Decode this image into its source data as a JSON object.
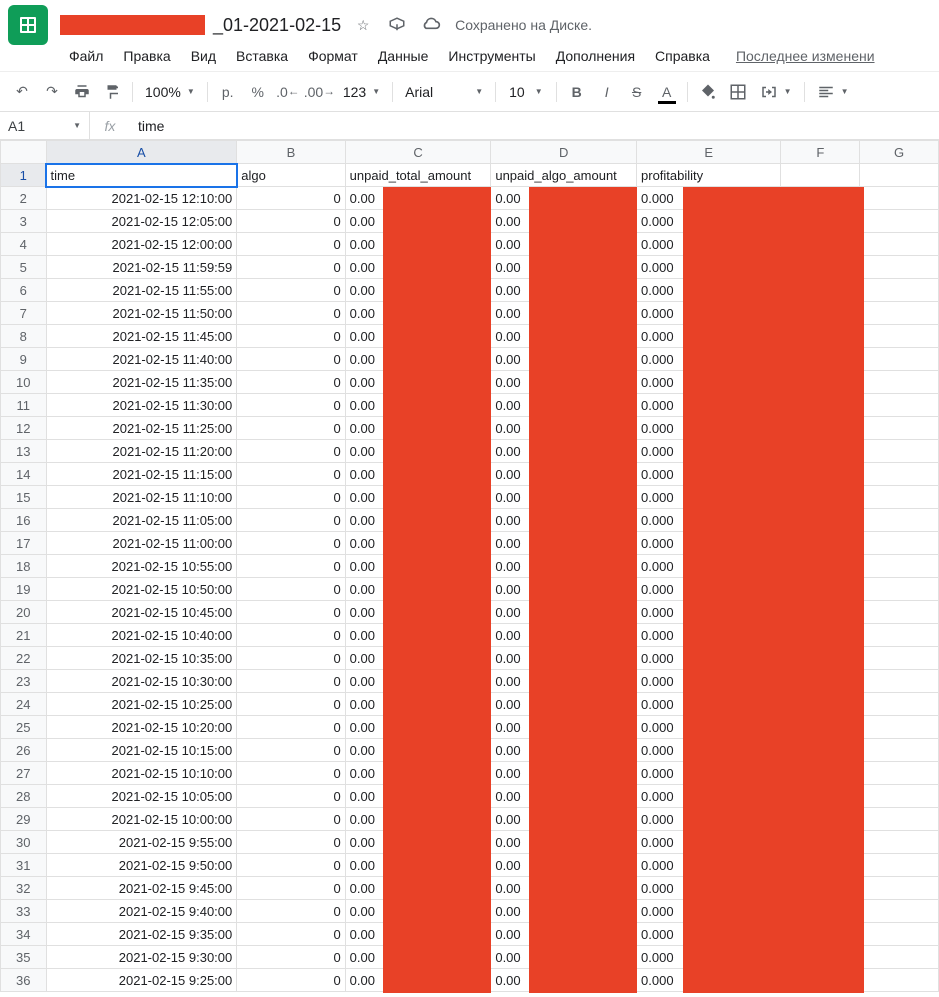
{
  "header": {
    "title_suffix": "_01-2021-02-15",
    "saved_text": "Сохранено на Диске."
  },
  "menu": {
    "items": [
      "Файл",
      "Правка",
      "Вид",
      "Вставка",
      "Формат",
      "Данные",
      "Инструменты",
      "Дополнения",
      "Справка"
    ],
    "last_edit": "Последнее изменени"
  },
  "toolbar": {
    "zoom": "100%",
    "currency": "р.",
    "font": "Arial",
    "font_size": "10"
  },
  "namebox": {
    "cell": "A1",
    "value": "time"
  },
  "columns": [
    "A",
    "B",
    "C",
    "D",
    "E",
    "F",
    "G"
  ],
  "headers": {
    "A": "time",
    "B": "algo",
    "C": "unpaid_total_amount",
    "D": "unpaid_algo_amount",
    "E": "profitability"
  },
  "rows": [
    {
      "n": 2,
      "time": "2021-02-15 12:10:00",
      "algo": "0",
      "c": "0.00",
      "d": "0.00",
      "e": "0.000"
    },
    {
      "n": 3,
      "time": "2021-02-15 12:05:00",
      "algo": "0",
      "c": "0.00",
      "d": "0.00",
      "e": "0.000"
    },
    {
      "n": 4,
      "time": "2021-02-15 12:00:00",
      "algo": "0",
      "c": "0.00",
      "d": "0.00",
      "e": "0.000"
    },
    {
      "n": 5,
      "time": "2021-02-15 11:59:59",
      "algo": "0",
      "c": "0.00",
      "d": "0.00",
      "e": "0.000"
    },
    {
      "n": 6,
      "time": "2021-02-15 11:55:00",
      "algo": "0",
      "c": "0.00",
      "d": "0.00",
      "e": "0.000"
    },
    {
      "n": 7,
      "time": "2021-02-15 11:50:00",
      "algo": "0",
      "c": "0.00",
      "d": "0.00",
      "e": "0.000"
    },
    {
      "n": 8,
      "time": "2021-02-15 11:45:00",
      "algo": "0",
      "c": "0.00",
      "d": "0.00",
      "e": "0.000"
    },
    {
      "n": 9,
      "time": "2021-02-15 11:40:00",
      "algo": "0",
      "c": "0.00",
      "d": "0.00",
      "e": "0.000"
    },
    {
      "n": 10,
      "time": "2021-02-15 11:35:00",
      "algo": "0",
      "c": "0.00",
      "d": "0.00",
      "e": "0.000"
    },
    {
      "n": 11,
      "time": "2021-02-15 11:30:00",
      "algo": "0",
      "c": "0.00",
      "d": "0.00",
      "e": "0.000"
    },
    {
      "n": 12,
      "time": "2021-02-15 11:25:00",
      "algo": "0",
      "c": "0.00",
      "d": "0.00",
      "e": "0.000"
    },
    {
      "n": 13,
      "time": "2021-02-15 11:20:00",
      "algo": "0",
      "c": "0.00",
      "d": "0.00",
      "e": "0.000"
    },
    {
      "n": 14,
      "time": "2021-02-15 11:15:00",
      "algo": "0",
      "c": "0.00",
      "d": "0.00",
      "e": "0.000"
    },
    {
      "n": 15,
      "time": "2021-02-15 11:10:00",
      "algo": "0",
      "c": "0.00",
      "d": "0.00",
      "e": "0.000"
    },
    {
      "n": 16,
      "time": "2021-02-15 11:05:00",
      "algo": "0",
      "c": "0.00",
      "d": "0.00",
      "e": "0.000"
    },
    {
      "n": 17,
      "time": "2021-02-15 11:00:00",
      "algo": "0",
      "c": "0.00",
      "d": "0.00",
      "e": "0.000"
    },
    {
      "n": 18,
      "time": "2021-02-15 10:55:00",
      "algo": "0",
      "c": "0.00",
      "d": "0.00",
      "e": "0.000"
    },
    {
      "n": 19,
      "time": "2021-02-15 10:50:00",
      "algo": "0",
      "c": "0.00",
      "d": "0.00",
      "e": "0.000"
    },
    {
      "n": 20,
      "time": "2021-02-15 10:45:00",
      "algo": "0",
      "c": "0.00",
      "d": "0.00",
      "e": "0.000"
    },
    {
      "n": 21,
      "time": "2021-02-15 10:40:00",
      "algo": "0",
      "c": "0.00",
      "d": "0.00",
      "e": "0.000"
    },
    {
      "n": 22,
      "time": "2021-02-15 10:35:00",
      "algo": "0",
      "c": "0.00",
      "d": "0.00",
      "e": "0.000"
    },
    {
      "n": 23,
      "time": "2021-02-15 10:30:00",
      "algo": "0",
      "c": "0.00",
      "d": "0.00",
      "e": "0.000"
    },
    {
      "n": 24,
      "time": "2021-02-15 10:25:00",
      "algo": "0",
      "c": "0.00",
      "d": "0.00",
      "e": "0.000"
    },
    {
      "n": 25,
      "time": "2021-02-15 10:20:00",
      "algo": "0",
      "c": "0.00",
      "d": "0.00",
      "e": "0.000"
    },
    {
      "n": 26,
      "time": "2021-02-15 10:15:00",
      "algo": "0",
      "c": "0.00",
      "d": "0.00",
      "e": "0.000"
    },
    {
      "n": 27,
      "time": "2021-02-15 10:10:00",
      "algo": "0",
      "c": "0.00",
      "d": "0.00",
      "e": "0.000"
    },
    {
      "n": 28,
      "time": "2021-02-15 10:05:00",
      "algo": "0",
      "c": "0.00",
      "d": "0.00",
      "e": "0.000"
    },
    {
      "n": 29,
      "time": "2021-02-15 10:00:00",
      "algo": "0",
      "c": "0.00",
      "d": "0.00",
      "e": "0.000"
    },
    {
      "n": 30,
      "time": "2021-02-15 9:55:00",
      "algo": "0",
      "c": "0.00",
      "d": "0.00",
      "e": "0.000"
    },
    {
      "n": 31,
      "time": "2021-02-15 9:50:00",
      "algo": "0",
      "c": "0.00",
      "d": "0.00",
      "e": "0.000"
    },
    {
      "n": 32,
      "time": "2021-02-15 9:45:00",
      "algo": "0",
      "c": "0.00",
      "d": "0.00",
      "e": "0.000"
    },
    {
      "n": 33,
      "time": "2021-02-15 9:40:00",
      "algo": "0",
      "c": "0.00",
      "d": "0.00",
      "e": "0.000"
    },
    {
      "n": 34,
      "time": "2021-02-15 9:35:00",
      "algo": "0",
      "c": "0.00",
      "d": "0.00",
      "e": "0.000"
    },
    {
      "n": 35,
      "time": "2021-02-15 9:30:00",
      "algo": "0",
      "c": "0.00",
      "d": "0.00",
      "e": "0.000"
    },
    {
      "n": 36,
      "time": "2021-02-15 9:25:00",
      "algo": "0",
      "c": "0.00",
      "d": "0.00",
      "e": "0.000"
    }
  ]
}
